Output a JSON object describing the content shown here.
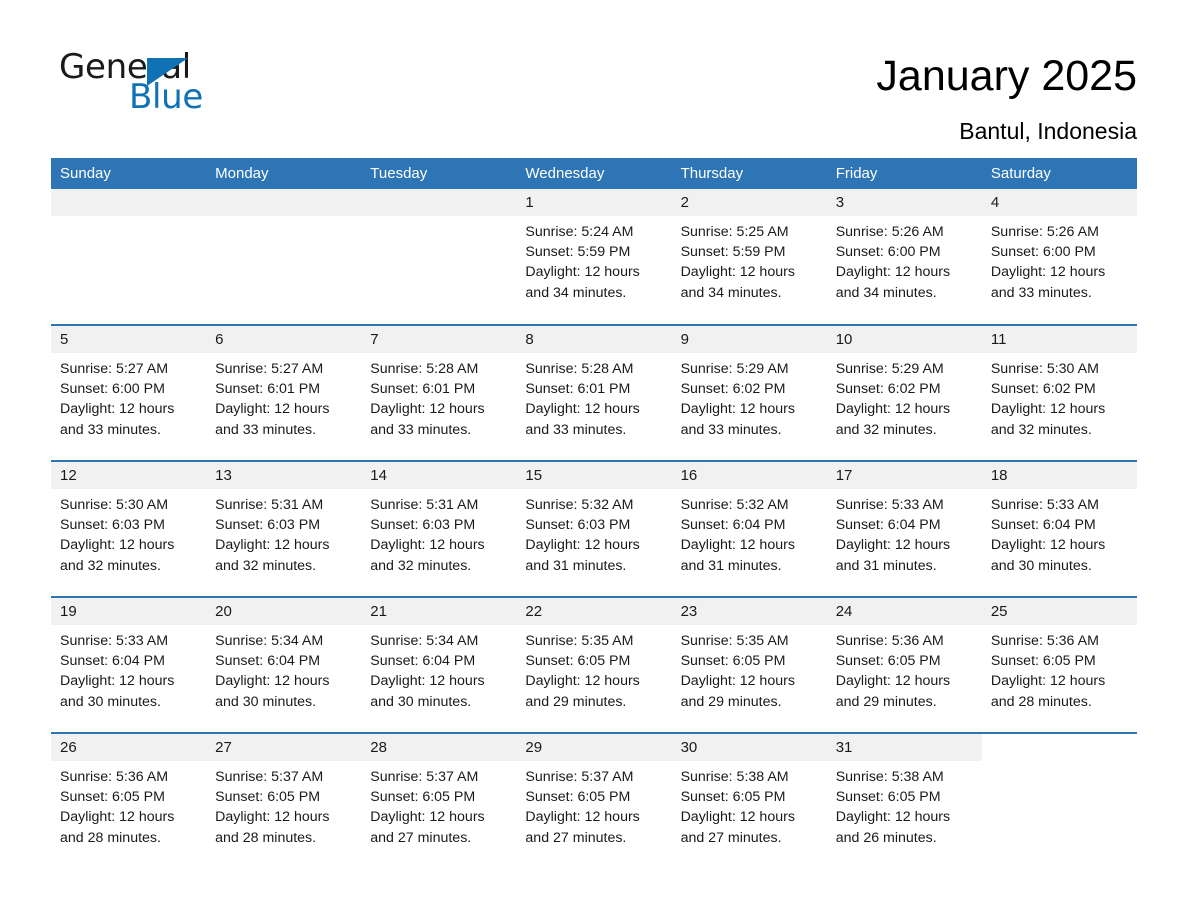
{
  "logo": {
    "word_one": "General",
    "word_two": "Blue",
    "triangle_icon": "triangle-icon",
    "brand_color": "#0e72b5"
  },
  "header": {
    "title": "January 2025",
    "subtitle": "Bantul, Indonesia"
  },
  "theme": {
    "header_blue": "#2e75b6",
    "daynum_band": "#f1f1f1",
    "text": "#1a1a1a"
  },
  "calendar": {
    "weekday_headers": [
      "Sunday",
      "Monday",
      "Tuesday",
      "Wednesday",
      "Thursday",
      "Friday",
      "Saturday"
    ],
    "weeks": [
      [
        {
          "day": "",
          "empty": true
        },
        {
          "day": "",
          "empty": true
        },
        {
          "day": "",
          "empty": true
        },
        {
          "day": "1",
          "sunrise": "Sunrise: 5:24 AM",
          "sunset": "Sunset: 5:59 PM",
          "daylight_line1": "Daylight: 12 hours",
          "daylight_line2": "and 34 minutes."
        },
        {
          "day": "2",
          "sunrise": "Sunrise: 5:25 AM",
          "sunset": "Sunset: 5:59 PM",
          "daylight_line1": "Daylight: 12 hours",
          "daylight_line2": "and 34 minutes."
        },
        {
          "day": "3",
          "sunrise": "Sunrise: 5:26 AM",
          "sunset": "Sunset: 6:00 PM",
          "daylight_line1": "Daylight: 12 hours",
          "daylight_line2": "and 34 minutes."
        },
        {
          "day": "4",
          "sunrise": "Sunrise: 5:26 AM",
          "sunset": "Sunset: 6:00 PM",
          "daylight_line1": "Daylight: 12 hours",
          "daylight_line2": "and 33 minutes."
        }
      ],
      [
        {
          "day": "5",
          "sunrise": "Sunrise: 5:27 AM",
          "sunset": "Sunset: 6:00 PM",
          "daylight_line1": "Daylight: 12 hours",
          "daylight_line2": "and 33 minutes."
        },
        {
          "day": "6",
          "sunrise": "Sunrise: 5:27 AM",
          "sunset": "Sunset: 6:01 PM",
          "daylight_line1": "Daylight: 12 hours",
          "daylight_line2": "and 33 minutes."
        },
        {
          "day": "7",
          "sunrise": "Sunrise: 5:28 AM",
          "sunset": "Sunset: 6:01 PM",
          "daylight_line1": "Daylight: 12 hours",
          "daylight_line2": "and 33 minutes."
        },
        {
          "day": "8",
          "sunrise": "Sunrise: 5:28 AM",
          "sunset": "Sunset: 6:01 PM",
          "daylight_line1": "Daylight: 12 hours",
          "daylight_line2": "and 33 minutes."
        },
        {
          "day": "9",
          "sunrise": "Sunrise: 5:29 AM",
          "sunset": "Sunset: 6:02 PM",
          "daylight_line1": "Daylight: 12 hours",
          "daylight_line2": "and 33 minutes."
        },
        {
          "day": "10",
          "sunrise": "Sunrise: 5:29 AM",
          "sunset": "Sunset: 6:02 PM",
          "daylight_line1": "Daylight: 12 hours",
          "daylight_line2": "and 32 minutes."
        },
        {
          "day": "11",
          "sunrise": "Sunrise: 5:30 AM",
          "sunset": "Sunset: 6:02 PM",
          "daylight_line1": "Daylight: 12 hours",
          "daylight_line2": "and 32 minutes."
        }
      ],
      [
        {
          "day": "12",
          "sunrise": "Sunrise: 5:30 AM",
          "sunset": "Sunset: 6:03 PM",
          "daylight_line1": "Daylight: 12 hours",
          "daylight_line2": "and 32 minutes."
        },
        {
          "day": "13",
          "sunrise": "Sunrise: 5:31 AM",
          "sunset": "Sunset: 6:03 PM",
          "daylight_line1": "Daylight: 12 hours",
          "daylight_line2": "and 32 minutes."
        },
        {
          "day": "14",
          "sunrise": "Sunrise: 5:31 AM",
          "sunset": "Sunset: 6:03 PM",
          "daylight_line1": "Daylight: 12 hours",
          "daylight_line2": "and 32 minutes."
        },
        {
          "day": "15",
          "sunrise": "Sunrise: 5:32 AM",
          "sunset": "Sunset: 6:03 PM",
          "daylight_line1": "Daylight: 12 hours",
          "daylight_line2": "and 31 minutes."
        },
        {
          "day": "16",
          "sunrise": "Sunrise: 5:32 AM",
          "sunset": "Sunset: 6:04 PM",
          "daylight_line1": "Daylight: 12 hours",
          "daylight_line2": "and 31 minutes."
        },
        {
          "day": "17",
          "sunrise": "Sunrise: 5:33 AM",
          "sunset": "Sunset: 6:04 PM",
          "daylight_line1": "Daylight: 12 hours",
          "daylight_line2": "and 31 minutes."
        },
        {
          "day": "18",
          "sunrise": "Sunrise: 5:33 AM",
          "sunset": "Sunset: 6:04 PM",
          "daylight_line1": "Daylight: 12 hours",
          "daylight_line2": "and 30 minutes."
        }
      ],
      [
        {
          "day": "19",
          "sunrise": "Sunrise: 5:33 AM",
          "sunset": "Sunset: 6:04 PM",
          "daylight_line1": "Daylight: 12 hours",
          "daylight_line2": "and 30 minutes."
        },
        {
          "day": "20",
          "sunrise": "Sunrise: 5:34 AM",
          "sunset": "Sunset: 6:04 PM",
          "daylight_line1": "Daylight: 12 hours",
          "daylight_line2": "and 30 minutes."
        },
        {
          "day": "21",
          "sunrise": "Sunrise: 5:34 AM",
          "sunset": "Sunset: 6:04 PM",
          "daylight_line1": "Daylight: 12 hours",
          "daylight_line2": "and 30 minutes."
        },
        {
          "day": "22",
          "sunrise": "Sunrise: 5:35 AM",
          "sunset": "Sunset: 6:05 PM",
          "daylight_line1": "Daylight: 12 hours",
          "daylight_line2": "and 29 minutes."
        },
        {
          "day": "23",
          "sunrise": "Sunrise: 5:35 AM",
          "sunset": "Sunset: 6:05 PM",
          "daylight_line1": "Daylight: 12 hours",
          "daylight_line2": "and 29 minutes."
        },
        {
          "day": "24",
          "sunrise": "Sunrise: 5:36 AM",
          "sunset": "Sunset: 6:05 PM",
          "daylight_line1": "Daylight: 12 hours",
          "daylight_line2": "and 29 minutes."
        },
        {
          "day": "25",
          "sunrise": "Sunrise: 5:36 AM",
          "sunset": "Sunset: 6:05 PM",
          "daylight_line1": "Daylight: 12 hours",
          "daylight_line2": "and 28 minutes."
        }
      ],
      [
        {
          "day": "26",
          "sunrise": "Sunrise: 5:36 AM",
          "sunset": "Sunset: 6:05 PM",
          "daylight_line1": "Daylight: 12 hours",
          "daylight_line2": "and 28 minutes."
        },
        {
          "day": "27",
          "sunrise": "Sunrise: 5:37 AM",
          "sunset": "Sunset: 6:05 PM",
          "daylight_line1": "Daylight: 12 hours",
          "daylight_line2": "and 28 minutes."
        },
        {
          "day": "28",
          "sunrise": "Sunrise: 5:37 AM",
          "sunset": "Sunset: 6:05 PM",
          "daylight_line1": "Daylight: 12 hours",
          "daylight_line2": "and 27 minutes."
        },
        {
          "day": "29",
          "sunrise": "Sunrise: 5:37 AM",
          "sunset": "Sunset: 6:05 PM",
          "daylight_line1": "Daylight: 12 hours",
          "daylight_line2": "and 27 minutes."
        },
        {
          "day": "30",
          "sunrise": "Sunrise: 5:38 AM",
          "sunset": "Sunset: 6:05 PM",
          "daylight_line1": "Daylight: 12 hours",
          "daylight_line2": "and 27 minutes."
        },
        {
          "day": "31",
          "sunrise": "Sunrise: 5:38 AM",
          "sunset": "Sunset: 6:05 PM",
          "daylight_line1": "Daylight: 12 hours",
          "daylight_line2": "and 26 minutes."
        },
        {
          "day": "",
          "empty": true,
          "blank": true
        }
      ]
    ]
  }
}
